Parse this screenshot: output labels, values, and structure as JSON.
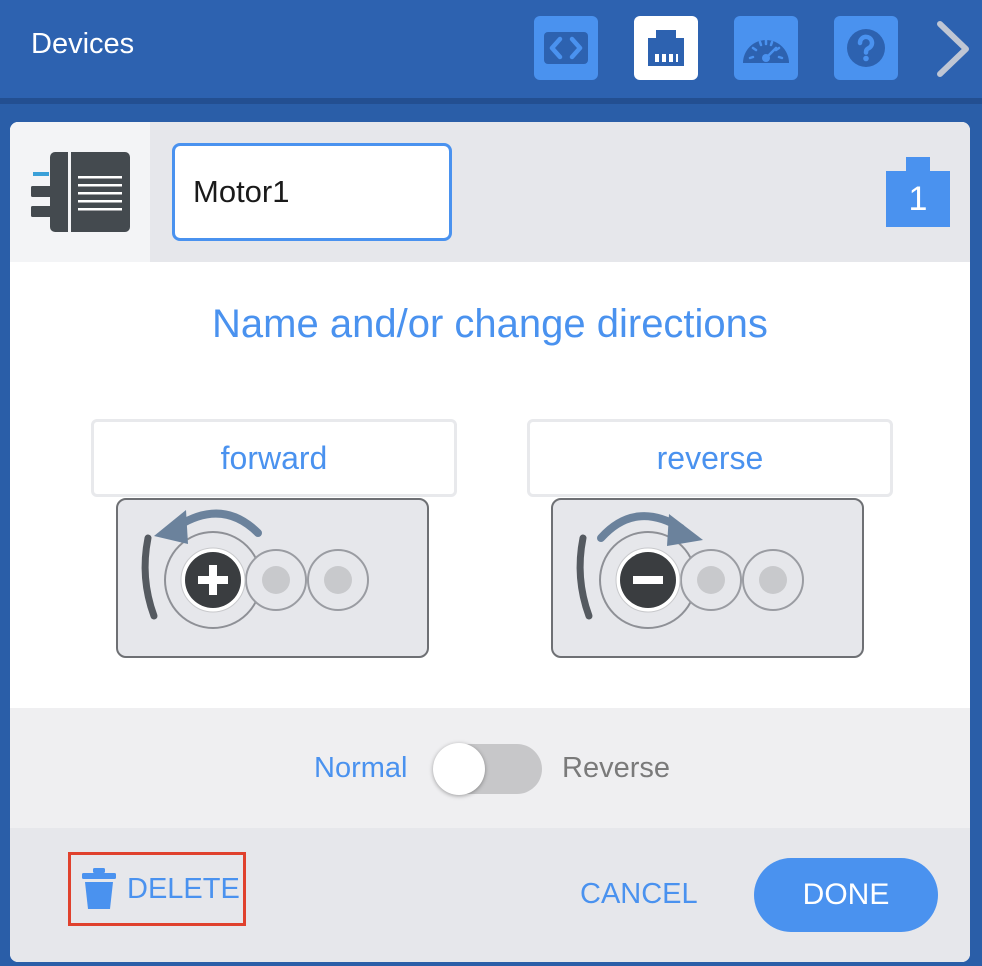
{
  "topbar": {
    "title": "Devices",
    "buttons": [
      {
        "name": "code-icon",
        "active": false
      },
      {
        "name": "ethernet-port-icon",
        "active": true
      },
      {
        "name": "dashboard-gauge-icon",
        "active": false
      },
      {
        "name": "help-icon",
        "active": false
      }
    ],
    "next_icon": "chevron-right-icon"
  },
  "dialog": {
    "device_icon": "motor-device-icon",
    "name_value": "Motor1",
    "port_number": "1",
    "heading": "Name and/or change directions",
    "directions": [
      {
        "label": "forward",
        "sign": "+"
      },
      {
        "label": "reverse",
        "sign": "−"
      }
    ],
    "toggle": {
      "left_label": "Normal",
      "right_label": "Reverse",
      "on": false
    },
    "footer": {
      "delete_label": "DELETE",
      "cancel_label": "CANCEL",
      "done_label": "DONE"
    }
  },
  "colors": {
    "topbar_bg": "#2d62b0",
    "accent": "#4a92ef",
    "highlight": "#e0412d"
  }
}
